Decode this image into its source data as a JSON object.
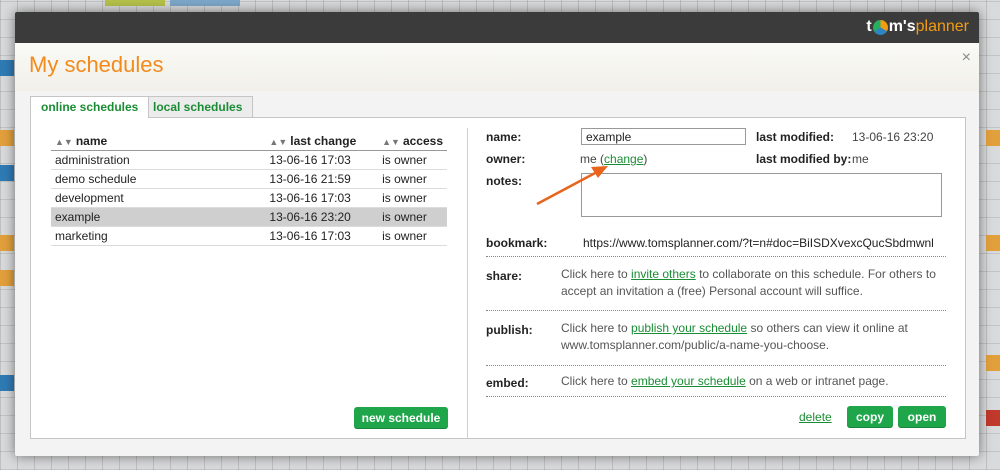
{
  "app": {
    "logo_a": "t",
    "logo_b": "m's",
    "logo_c": "planner"
  },
  "dialog": {
    "title": "My schedules",
    "close": "×"
  },
  "tabs": [
    {
      "label": "online schedules"
    },
    {
      "label": "local schedules"
    }
  ],
  "list": {
    "headers": {
      "name": "name",
      "last_change": "last change",
      "access": "access"
    },
    "rows": [
      {
        "name": "administration",
        "last_change": "13-06-16 17:03",
        "access": "is owner"
      },
      {
        "name": "demo schedule",
        "last_change": "13-06-16 21:59",
        "access": "is owner"
      },
      {
        "name": "development",
        "last_change": "13-06-16 17:03",
        "access": "is owner"
      },
      {
        "name": "example",
        "last_change": "13-06-16 23:20",
        "access": "is owner"
      },
      {
        "name": "marketing",
        "last_change": "13-06-16 17:03",
        "access": "is owner"
      }
    ],
    "new_button": "new schedule"
  },
  "details": {
    "name_label": "name:",
    "name_value": "example",
    "last_modified_label": "last modified:",
    "last_modified_value": "13-06-16 23:20",
    "owner_label": "owner:",
    "owner_value": "me",
    "owner_change": "change",
    "last_modified_by_label": "last modified by:",
    "last_modified_by_value": "me",
    "notes_label": "notes:",
    "notes_value": "",
    "bookmark_label": "bookmark:",
    "bookmark_value": "https://www.tomsplanner.com/?t=n#doc=BiISDXvexcQucSbdmwnl",
    "share_label": "share:",
    "share_pre": "Click here to ",
    "share_link": "invite others",
    "share_post": " to collaborate on this schedule. For others to",
    "share_line2": "accept an invitation a (free) Personal account will suffice.",
    "publish_label": "publish:",
    "publish_pre": "Click here to ",
    "publish_link": "publish your schedule",
    "publish_post": " so others can view it online at",
    "publish_line2": "www.tomsplanner.com/public/a-name-you-choose.",
    "embed_label": "embed:",
    "embed_pre": "Click here to ",
    "embed_link": "embed your schedule",
    "embed_post": " on a web or intranet page.",
    "delete": "delete",
    "copy": "copy",
    "open": "open"
  },
  "colors": {
    "accent": "#f28a1c",
    "green": "#1fa54a",
    "dark": "#3b3b3b"
  }
}
